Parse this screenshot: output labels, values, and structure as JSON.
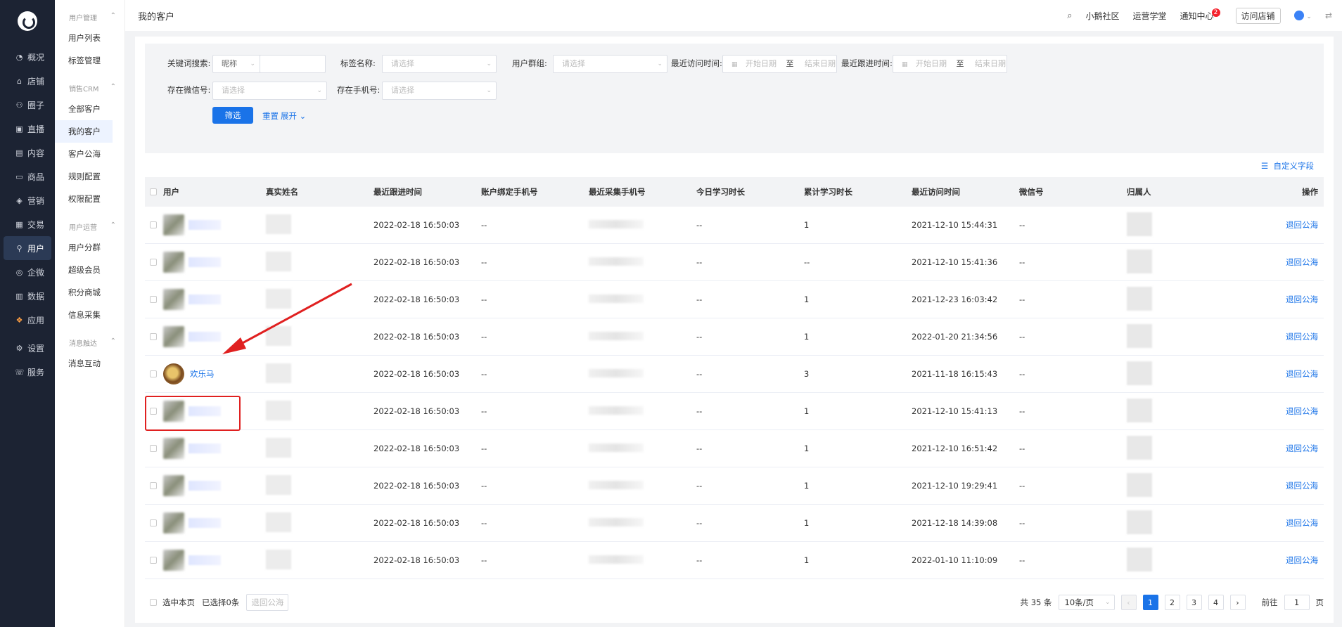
{
  "rail": {
    "items": [
      {
        "icon": "dashboard-icon",
        "glyph": "◔",
        "label": "概况"
      },
      {
        "icon": "store-icon",
        "glyph": "⌂",
        "label": "店铺"
      },
      {
        "icon": "circle-group-icon",
        "glyph": "⚇",
        "label": "圈子"
      },
      {
        "icon": "live-icon",
        "glyph": "▣",
        "label": "直播"
      },
      {
        "icon": "content-icon",
        "glyph": "▤",
        "label": "内容"
      },
      {
        "icon": "goods-icon",
        "glyph": "▭",
        "label": "商品"
      },
      {
        "icon": "marketing-icon",
        "glyph": "◈",
        "label": "营销"
      },
      {
        "icon": "trade-icon",
        "glyph": "▦",
        "label": "交易"
      },
      {
        "icon": "user-icon",
        "glyph": "⚲",
        "label": "用户"
      },
      {
        "icon": "wecom-icon",
        "glyph": "◎",
        "label": "企微"
      },
      {
        "icon": "data-icon",
        "glyph": "▥",
        "label": "数据"
      },
      {
        "icon": "apps-icon",
        "glyph": "❖",
        "label": "应用"
      },
      {
        "icon": "settings-icon",
        "glyph": "⚙",
        "label": "设置"
      },
      {
        "icon": "service-icon",
        "glyph": "☏",
        "label": "服务"
      }
    ]
  },
  "side": {
    "groups": [
      {
        "title": "用户管理",
        "items": [
          "用户列表",
          "标签管理"
        ]
      },
      {
        "title": "销售CRM",
        "items": [
          "全部客户",
          "我的客户",
          "客户公海",
          "规则配置",
          "权限配置"
        ]
      },
      {
        "title": "用户运营",
        "items": [
          "用户分群",
          "超级会员",
          "积分商城",
          "信息采集"
        ]
      },
      {
        "title": "消息触达",
        "items": [
          "消息互动"
        ]
      }
    ]
  },
  "topbar": {
    "title": "我的客户",
    "community": "小鹅社区",
    "academy": "运营学堂",
    "notice": "通知中心",
    "notice_count": "2",
    "visit_store": "访问店铺"
  },
  "filters": {
    "keyword_label": "关键词搜索:",
    "keyword_type": "昵称",
    "tag_label": "标签名称:",
    "tag_placeholder": "请选择",
    "group_label": "用户群组:",
    "group_placeholder": "请选择",
    "visit_label": "最近访问时间:",
    "follow_label": "最近跟进时间:",
    "start_placeholder": "开始日期",
    "end_placeholder": "结束日期",
    "to": "至",
    "wechat_label": "存在微信号:",
    "wechat_placeholder": "请选择",
    "phone_label": "存在手机号:",
    "phone_placeholder": "请选择",
    "filter_btn": "筛选",
    "reset_btn": "重置",
    "expand_btn": "展开"
  },
  "custom_field": "自定义字段",
  "table": {
    "headers": [
      "用户",
      "真实姓名",
      "最近跟进时间",
      "账户绑定手机号",
      "最近采集手机号",
      "今日学习时长",
      "累计学习时长",
      "最近访问时间",
      "微信号",
      "归属人",
      "操作"
    ],
    "rows": [
      {
        "user": "",
        "follow": "2022-02-18 16:50:03",
        "bind": "--",
        "collected": "",
        "today": "--",
        "total": "1",
        "visit": "2021-12-10 15:44:31",
        "wx": "--",
        "op": "退回公海"
      },
      {
        "user": "",
        "follow": "2022-02-18 16:50:03",
        "bind": "--",
        "collected": "",
        "today": "--",
        "total": "--",
        "visit": "2021-12-10 15:41:36",
        "wx": "--",
        "op": "退回公海"
      },
      {
        "user": "",
        "follow": "2022-02-18 16:50:03",
        "bind": "--",
        "collected": "",
        "today": "--",
        "total": "1",
        "visit": "2021-12-23 16:03:42",
        "wx": "--",
        "op": "退回公海"
      },
      {
        "user": "",
        "follow": "2022-02-18 16:50:03",
        "bind": "--",
        "collected": "",
        "today": "--",
        "total": "1",
        "visit": "2022-01-20 21:34:56",
        "wx": "--",
        "op": "退回公海"
      },
      {
        "user": "欢乐马",
        "follow": "2022-02-18 16:50:03",
        "bind": "--",
        "collected": "",
        "today": "--",
        "total": "3",
        "visit": "2021-11-18 16:15:43",
        "wx": "--",
        "op": "退回公海"
      },
      {
        "user": "",
        "follow": "2022-02-18 16:50:03",
        "bind": "--",
        "collected": "",
        "today": "--",
        "total": "1",
        "visit": "2021-12-10 15:41:13",
        "wx": "--",
        "op": "退回公海"
      },
      {
        "user": "",
        "follow": "2022-02-18 16:50:03",
        "bind": "--",
        "collected": "",
        "today": "--",
        "total": "1",
        "visit": "2021-12-10 16:51:42",
        "wx": "--",
        "op": "退回公海"
      },
      {
        "user": "",
        "follow": "2022-02-18 16:50:03",
        "bind": "--",
        "collected": "",
        "today": "--",
        "total": "1",
        "visit": "2021-12-10 19:29:41",
        "wx": "--",
        "op": "退回公海"
      },
      {
        "user": "",
        "follow": "2022-02-18 16:50:03",
        "bind": "--",
        "collected": "",
        "today": "--",
        "total": "1",
        "visit": "2021-12-18 14:39:08",
        "wx": "--",
        "op": "退回公海"
      },
      {
        "user": "",
        "follow": "2022-02-18 16:50:03",
        "bind": "--",
        "collected": "",
        "today": "--",
        "total": "1",
        "visit": "2022-01-10 11:10:09",
        "wx": "--",
        "op": "退回公海"
      }
    ]
  },
  "footer": {
    "select_page": "选中本页",
    "selected": "已选择0条",
    "return_btn": "退回公海",
    "total": "共 35 条",
    "page_size": "10条/页",
    "pages": [
      "1",
      "2",
      "3",
      "4"
    ],
    "current_page": "1",
    "goto": "前往",
    "goto_value": "1",
    "page_unit": "页"
  },
  "colors": {
    "accent": "#1a73e8",
    "rail": "#1c2333",
    "highlight": "#e02020"
  }
}
